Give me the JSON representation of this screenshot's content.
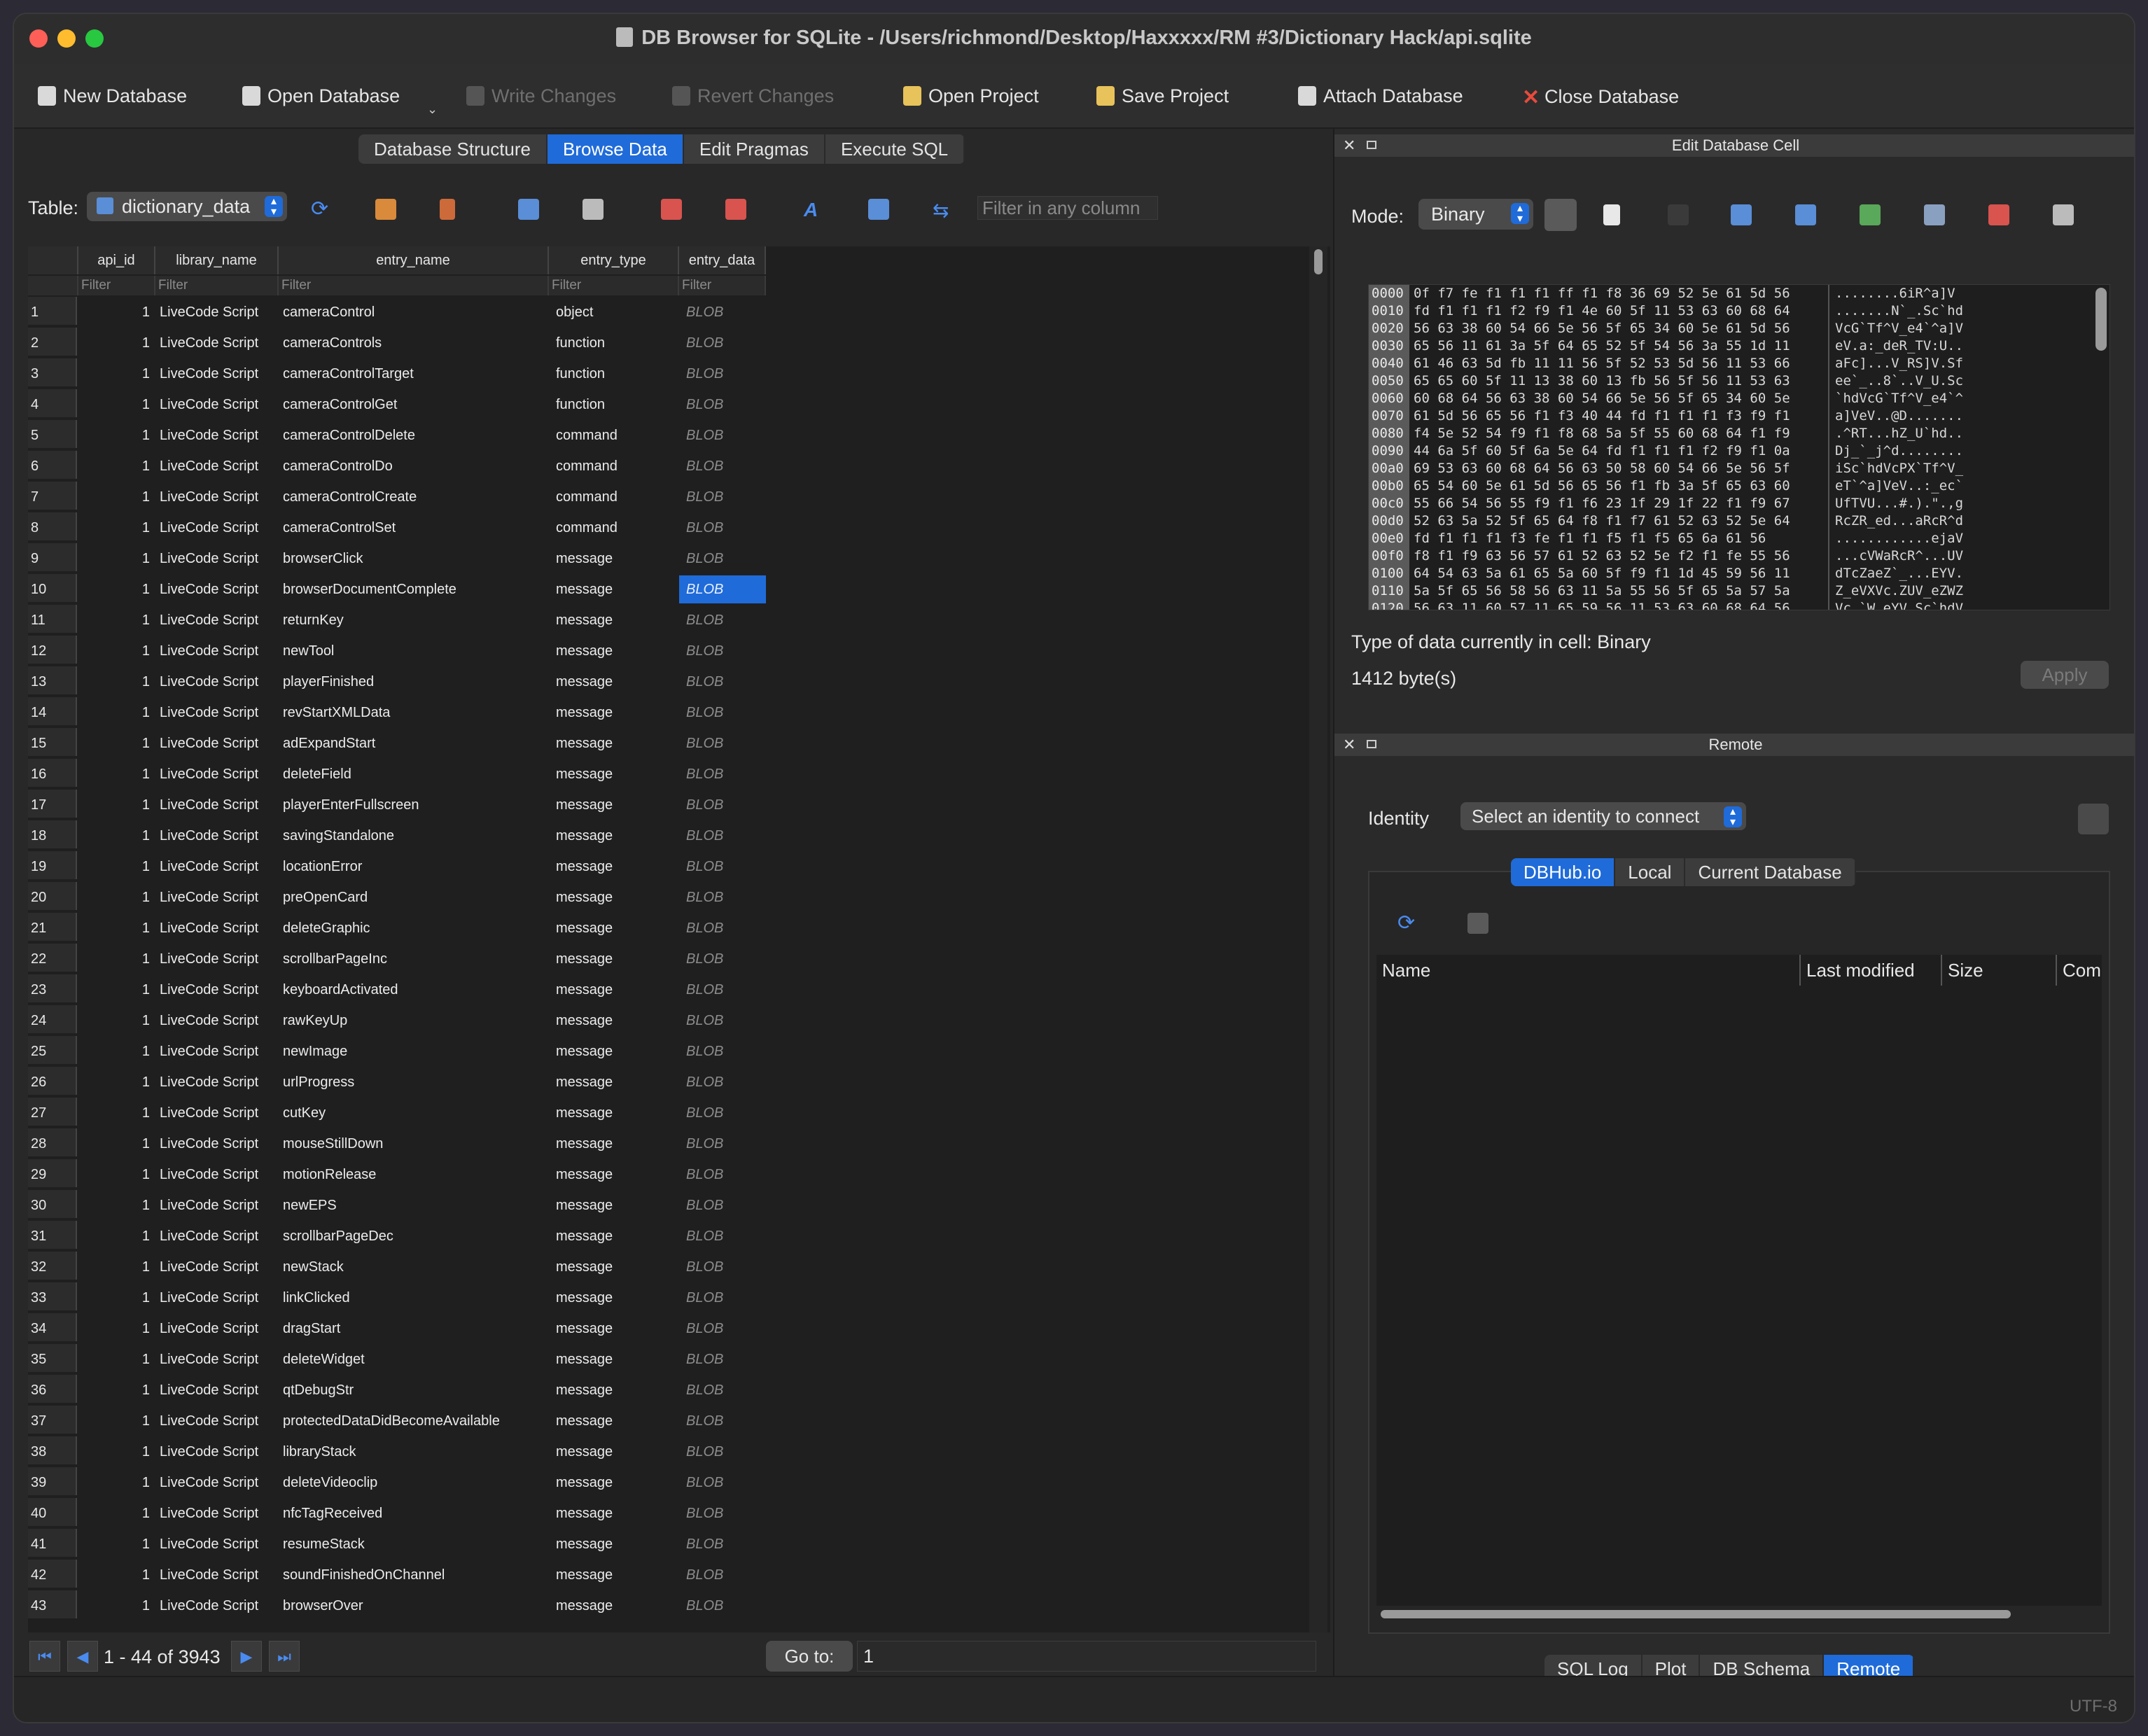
{
  "window": {
    "title": "DB Browser for SQLite - /Users/richmond/Desktop/Haxxxxx/RM #3/Dictionary Hack/api.sqlite",
    "traffic_lights": [
      "#ff5f57",
      "#febc2e",
      "#28c840"
    ]
  },
  "toolbar": {
    "new_database": "New Database",
    "open_database": "Open Database",
    "write_changes": "Write Changes",
    "revert_changes": "Revert Changes",
    "open_project": "Open Project",
    "save_project": "Save Project",
    "attach_database": "Attach Database",
    "close_database": "Close Database"
  },
  "tabs": [
    "Database Structure",
    "Browse Data",
    "Edit Pragmas",
    "Execute SQL"
  ],
  "browse": {
    "table_label": "Table:",
    "table_selected": "dictionary_data",
    "filter_any_placeholder": "Filter in any column",
    "filter_placeholder": "Filter",
    "columns": [
      "api_id",
      "library_name",
      "entry_name",
      "entry_type",
      "entry_data"
    ],
    "rows": [
      [
        "1",
        "1",
        "LiveCode Script",
        "cameraControl",
        "object",
        "BLOB"
      ],
      [
        "2",
        "1",
        "LiveCode Script",
        "cameraControls",
        "function",
        "BLOB"
      ],
      [
        "3",
        "1",
        "LiveCode Script",
        "cameraControlTarget",
        "function",
        "BLOB"
      ],
      [
        "4",
        "1",
        "LiveCode Script",
        "cameraControlGet",
        "function",
        "BLOB"
      ],
      [
        "5",
        "1",
        "LiveCode Script",
        "cameraControlDelete",
        "command",
        "BLOB"
      ],
      [
        "6",
        "1",
        "LiveCode Script",
        "cameraControlDo",
        "command",
        "BLOB"
      ],
      [
        "7",
        "1",
        "LiveCode Script",
        "cameraControlCreate",
        "command",
        "BLOB"
      ],
      [
        "8",
        "1",
        "LiveCode Script",
        "cameraControlSet",
        "command",
        "BLOB"
      ],
      [
        "9",
        "1",
        "LiveCode Script",
        "browserClick",
        "message",
        "BLOB"
      ],
      [
        "10",
        "1",
        "LiveCode Script",
        "browserDocumentComplete",
        "message",
        "BLOB"
      ],
      [
        "11",
        "1",
        "LiveCode Script",
        "returnKey",
        "message",
        "BLOB"
      ],
      [
        "12",
        "1",
        "LiveCode Script",
        "newTool",
        "message",
        "BLOB"
      ],
      [
        "13",
        "1",
        "LiveCode Script",
        "playerFinished",
        "message",
        "BLOB"
      ],
      [
        "14",
        "1",
        "LiveCode Script",
        "revStartXMLData",
        "message",
        "BLOB"
      ],
      [
        "15",
        "1",
        "LiveCode Script",
        "adExpandStart",
        "message",
        "BLOB"
      ],
      [
        "16",
        "1",
        "LiveCode Script",
        "deleteField",
        "message",
        "BLOB"
      ],
      [
        "17",
        "1",
        "LiveCode Script",
        "playerEnterFullscreen",
        "message",
        "BLOB"
      ],
      [
        "18",
        "1",
        "LiveCode Script",
        "savingStandalone",
        "message",
        "BLOB"
      ],
      [
        "19",
        "1",
        "LiveCode Script",
        "locationError",
        "message",
        "BLOB"
      ],
      [
        "20",
        "1",
        "LiveCode Script",
        "preOpenCard",
        "message",
        "BLOB"
      ],
      [
        "21",
        "1",
        "LiveCode Script",
        "deleteGraphic",
        "message",
        "BLOB"
      ],
      [
        "22",
        "1",
        "LiveCode Script",
        "scrollbarPageInc",
        "message",
        "BLOB"
      ],
      [
        "23",
        "1",
        "LiveCode Script",
        "keyboardActivated",
        "message",
        "BLOB"
      ],
      [
        "24",
        "1",
        "LiveCode Script",
        "rawKeyUp",
        "message",
        "BLOB"
      ],
      [
        "25",
        "1",
        "LiveCode Script",
        "newImage",
        "message",
        "BLOB"
      ],
      [
        "26",
        "1",
        "LiveCode Script",
        "urlProgress",
        "message",
        "BLOB"
      ],
      [
        "27",
        "1",
        "LiveCode Script",
        "cutKey",
        "message",
        "BLOB"
      ],
      [
        "28",
        "1",
        "LiveCode Script",
        "mouseStillDown",
        "message",
        "BLOB"
      ],
      [
        "29",
        "1",
        "LiveCode Script",
        "motionRelease",
        "message",
        "BLOB"
      ],
      [
        "30",
        "1",
        "LiveCode Script",
        "newEPS",
        "message",
        "BLOB"
      ],
      [
        "31",
        "1",
        "LiveCode Script",
        "scrollbarPageDec",
        "message",
        "BLOB"
      ],
      [
        "32",
        "1",
        "LiveCode Script",
        "newStack",
        "message",
        "BLOB"
      ],
      [
        "33",
        "1",
        "LiveCode Script",
        "linkClicked",
        "message",
        "BLOB"
      ],
      [
        "34",
        "1",
        "LiveCode Script",
        "dragStart",
        "message",
        "BLOB"
      ],
      [
        "35",
        "1",
        "LiveCode Script",
        "deleteWidget",
        "message",
        "BLOB"
      ],
      [
        "36",
        "1",
        "LiveCode Script",
        "qtDebugStr",
        "message",
        "BLOB"
      ],
      [
        "37",
        "1",
        "LiveCode Script",
        "protectedDataDidBecomeAvailable",
        "message",
        "BLOB"
      ],
      [
        "38",
        "1",
        "LiveCode Script",
        "libraryStack",
        "message",
        "BLOB"
      ],
      [
        "39",
        "1",
        "LiveCode Script",
        "deleteVideoclip",
        "message",
        "BLOB"
      ],
      [
        "40",
        "1",
        "LiveCode Script",
        "nfcTagReceived",
        "message",
        "BLOB"
      ],
      [
        "41",
        "1",
        "LiveCode Script",
        "resumeStack",
        "message",
        "BLOB"
      ],
      [
        "42",
        "1",
        "LiveCode Script",
        "soundFinishedOnChannel",
        "message",
        "BLOB"
      ],
      [
        "43",
        "1",
        "LiveCode Script",
        "browserOver",
        "message",
        "BLOB"
      ]
    ],
    "selected_row": "10",
    "page_range": "1 - 44 of 3943",
    "goto_label": "Go to:",
    "goto_value": "1"
  },
  "edit_cell": {
    "pane_title": "Edit Database Cell",
    "mode_label": "Mode:",
    "mode_value": "Binary",
    "hex_offsets": [
      "0000",
      "0010",
      "0020",
      "0030",
      "0040",
      "0050",
      "0060",
      "0070",
      "0080",
      "0090",
      "00a0",
      "00b0",
      "00c0",
      "00d0",
      "00e0",
      "00f0",
      "0100",
      "0110",
      "0120"
    ],
    "hex_lines": [
      "0f f7 fe f1 f1 f1 ff f1 f8 36 69 52 5e 61 5d 56",
      "fd f1 f1 f1 f2 f9 f1 4e 60 5f 11 53 63 60 68 64",
      "56 63 38 60 54 66 5e 56 5f 65 34 60 5e 61 5d 56",
      "65 56 11 61 3a 5f 64 65 52 5f 54 56 3a 55 1d 11",
      "61 46 63 5d fb 11 11 56 5f 52 53 5d 56 11 53 66",
      "65 65 60 5f 11 13 38 60 13 fb 56 5f 56 11 53 63",
      "60 68 64 56 63 38 60 54 66 5e 56 5f 65 34 60 5e",
      "61 5d 56 65 56 f1 f3 40 44 fd f1 f1 f1 f3 f9 f1",
      "f4 5e 52 54 f9 f1 f8 68 5a 5f 55 60 68 64 f1 f9",
      "44 6a 5f 60 5f 6a 5e 64 fd f1 f1 f1 f2 f9 f1 0a",
      "69 53 63 60 68 64 56 63 50 58 60 54 66 5e 56 5f",
      "65 54 60 5e 61 5d 56 65 56 f1 fb 3a 5f 65 63 60",
      "55 66 54 56 55 f9 f1 f6 23 1f 29 1f 22 f1 f9 67",
      "52 63 5a 52 5f 65 64 f8 f1 f7 61 52 63 52 5e 64",
      "fd f1 f1 f1 f3 fe f1 f1 f5 f1 f5 65 6a 61 56",
      "f8 f1 f9 63 56 57 61 52 63 52 5e f2 f1 fe 55 56",
      "64 54 63 5a 61 65 5a 60 5f f9 f1 1d 45 59 56 11",
      "5a 5f 65 56 58 56 63 11 5a 55 56 5f 65 5a 57 5a",
      "56 63 11 60 57 11 65 59 56 11 53 63 60 68 64 56"
    ],
    "ascii_lines": [
      "........6iR^a]V",
      ".......N`_.Sc`hd",
      "VcG`Tf^V_e4`^a]V",
      "eV.a:_deR_TV:U..",
      "aFc]...V_RS]V.Sf",
      "ee`_..8`..V_U.Sc",
      "`hdVcG`Tf^V_e4`^",
      "a]VeV..@D.......",
      ".^RT...hZ_U`hd..",
      "Dj_`_j^d........",
      "iSc`hdVcPX`Tf^V_",
      "eT`^a]VeV..:_ec`",
      "UfTVU...#.).\".,g",
      "RcZR_ed...aRcR^d",
      "............ejaV",
      "...cVWaRcR^...UV",
      "dTcZaeZ`_...EYV.",
      "Z_eVXVc.ZUV_eZWZ",
      "Vc.`W.eYV.Sc`hdV"
    ],
    "type_text": "Type of data currently in cell: Binary",
    "bytes_text": "1412 byte(s)",
    "apply_label": "Apply"
  },
  "remote": {
    "pane_title": "Remote",
    "identity_label": "Identity",
    "identity_placeholder": "Select an identity to connect",
    "tabs": [
      "DBHub.io",
      "Local",
      "Current Database"
    ],
    "columns": [
      "Name",
      "Last modified",
      "Size",
      "Com"
    ]
  },
  "bottom_tabs": [
    "SQL Log",
    "Plot",
    "DB Schema",
    "Remote"
  ],
  "status": {
    "encoding": "UTF-8"
  },
  "colors": {
    "accent": "#1f6bd9",
    "background": "#282828"
  }
}
